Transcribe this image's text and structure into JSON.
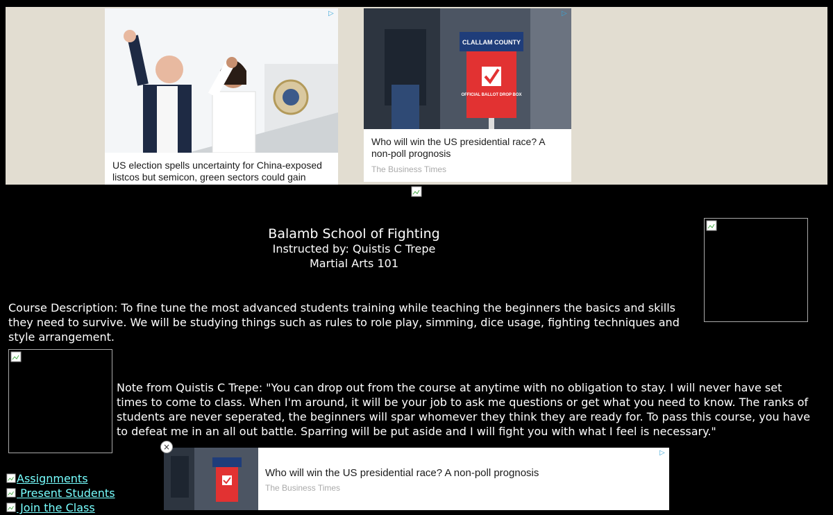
{
  "ads": {
    "ad1": {
      "title": "US election spells uncertainty for China-exposed listcos but semicon, green sectors could gain",
      "adchoice_icon": "adchoices-icon"
    },
    "ad2": {
      "title": "Who will win the US presidential race? A non-poll prognosis",
      "source": "The Business Times",
      "image_sign": {
        "county": "CLALLAM COUNTY",
        "box_text": "OFFICIAL BALLOT DROP BOX"
      }
    },
    "bottom": {
      "title": "Who will win the US presidential race? A non-poll prognosis",
      "source": "The Business Times",
      "close_label": "×"
    }
  },
  "header": {
    "school": "Balamb School of Fighting",
    "instructor": "Instructed by: Quistis C Trepe",
    "course": "Martial Arts 101"
  },
  "description": "Course Description: To fine tune the most advanced students training while teaching the beginners the basics and skills they need to survive. We will be studying things such as rules to role play, simming, dice usage, fighting techniques and style arrangement.",
  "note": "Note from Quistis C Trepe: \"You can drop out from the course at anytime with no obligation to stay. I will never have set times to come to class. When I'm around, it will be your job to ask me questions or get what you need to know. The ranks of students are never seperated, the beginners will spar whomever they think they are ready for. To pass this course, you have to defeat me in an all out battle. Sparring will be put aside and I will fight you with what I feel is necessary.\"",
  "links": [
    {
      "label": "Assignments"
    },
    {
      "label": " Present Students"
    },
    {
      "label": " Join the Class"
    }
  ],
  "colors": {
    "background": "#000000",
    "text": "#ffffff",
    "link": "#77ffff",
    "banner": "#e2ddd1"
  }
}
